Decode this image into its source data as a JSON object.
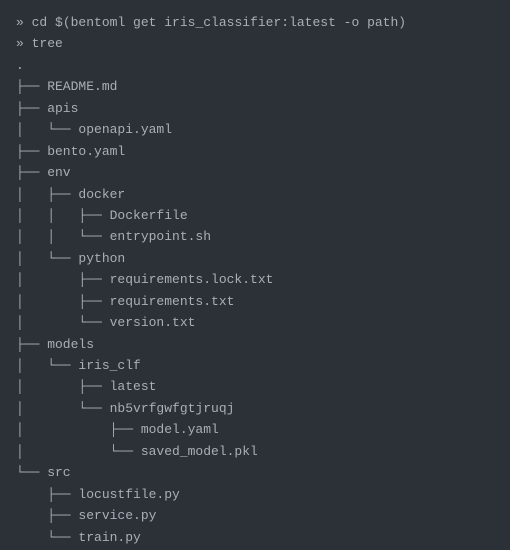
{
  "lines": [
    {
      "prompt": "»",
      "command": "cd $(bentoml get iris_classifier:latest -o path)"
    },
    {
      "prompt": "»",
      "command": "tree"
    }
  ],
  "tree": [
    ".",
    "├── README.md",
    "├── apis",
    "│   └── openapi.yaml",
    "├── bento.yaml",
    "├── env",
    "│   ├── docker",
    "│   │   ├── Dockerfile",
    "│   │   └── entrypoint.sh",
    "│   └── python",
    "│       ├── requirements.lock.txt",
    "│       ├── requirements.txt",
    "│       └── version.txt",
    "├── models",
    "│   └── iris_clf",
    "│       ├── latest",
    "│       └── nb5vrfgwfgtjruqj",
    "│           ├── model.yaml",
    "│           └── saved_model.pkl",
    "└── src",
    "    ├── locustfile.py",
    "    ├── service.py",
    "    └── train.py"
  ]
}
